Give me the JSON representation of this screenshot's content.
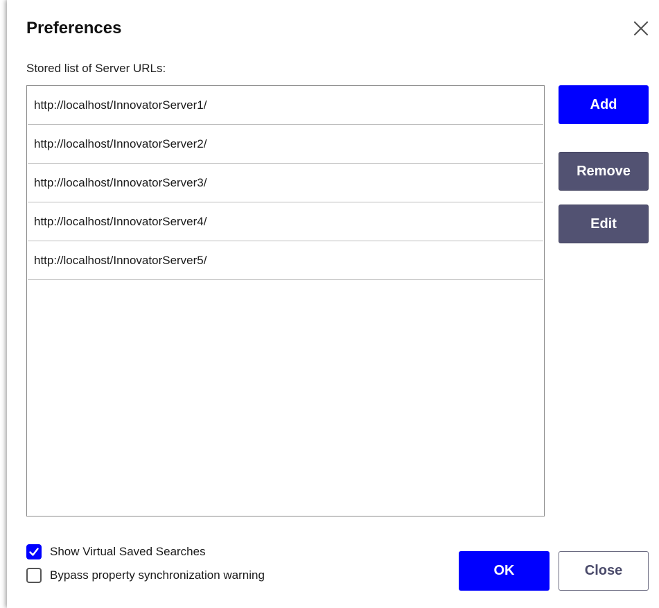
{
  "dialog": {
    "title": "Preferences",
    "close_icon": "close-x-icon"
  },
  "servers": {
    "label": "Stored list of Server URLs:",
    "items": [
      "http://localhost/InnovatorServer1/",
      "http://localhost/InnovatorServer2/",
      "http://localhost/InnovatorServer3/",
      "http://localhost/InnovatorServer4/",
      "http://localhost/InnovatorServer5/"
    ]
  },
  "actions": {
    "add_label": "Add",
    "remove_label": "Remove",
    "edit_label": "Edit"
  },
  "options": {
    "show_virtual_saved_searches": {
      "label": "Show Virtual Saved Searches",
      "checked": true
    },
    "bypass_sync_warning": {
      "label": "Bypass property synchronization warning",
      "checked": false
    }
  },
  "footer": {
    "ok_label": "OK",
    "close_label": "Close"
  },
  "colors": {
    "primary": "#0000ff",
    "secondary": "#525272",
    "text": "#1a1a1a"
  }
}
